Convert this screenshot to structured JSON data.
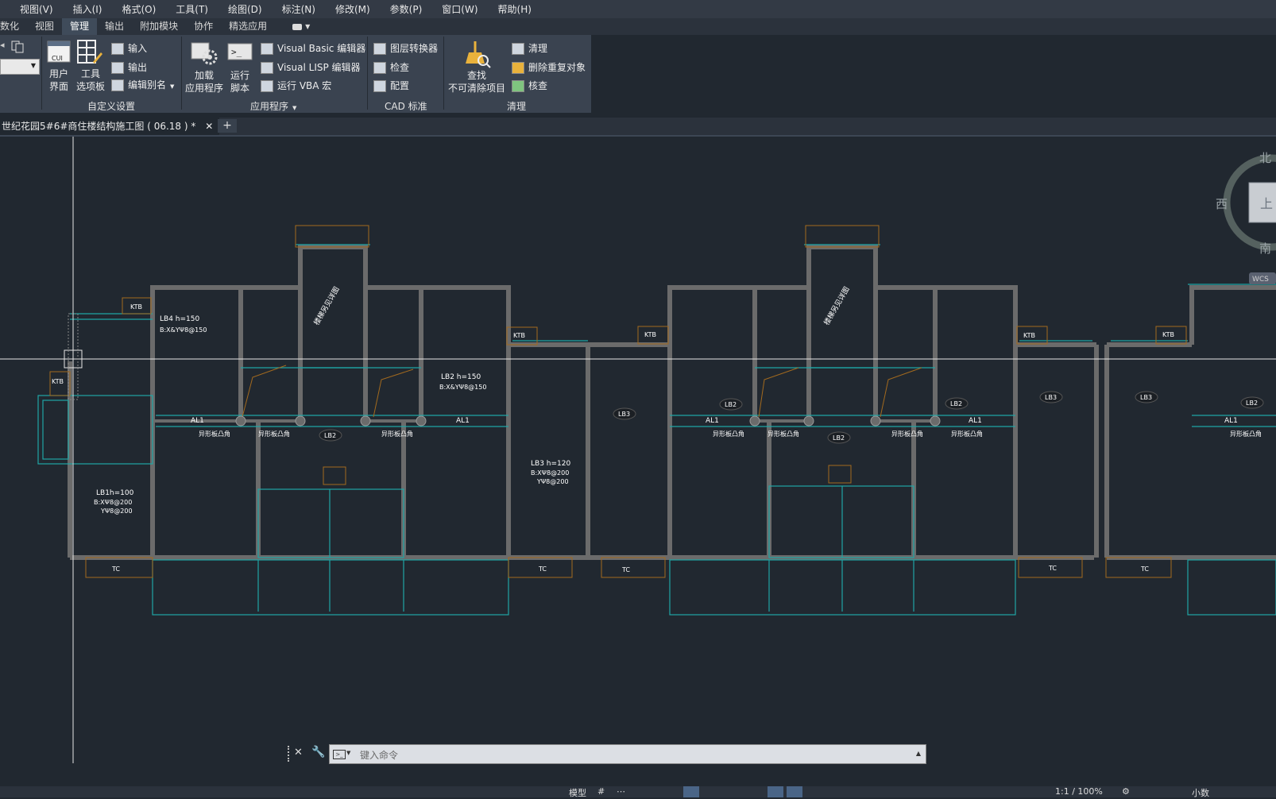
{
  "menubar": {
    "items": [
      "视图(V)",
      "插入(I)",
      "格式(O)",
      "工具(T)",
      "绘图(D)",
      "标注(N)",
      "修改(M)",
      "参数(P)",
      "窗口(W)",
      "帮助(H)"
    ]
  },
  "ribbon_tabs": [
    "参数化",
    "视图",
    "管理",
    "输出",
    "附加模块",
    "协作",
    "精选应用"
  ],
  "ribbon_active_tab": "管理",
  "ribbon": {
    "customize": {
      "title": "自定义设置",
      "user_interface": [
        "用户",
        "界面"
      ],
      "tool_palettes": [
        "工具",
        "选项板"
      ],
      "import": "输入",
      "export": "输出",
      "edit_aliases": "编辑别名"
    },
    "applications": {
      "title": "应用程序",
      "load_app": [
        "加载",
        "应用程序"
      ],
      "run_script": [
        "运行",
        "脚本"
      ],
      "vb_editor": "Visual Basic 编辑器",
      "lisp_editor": "Visual LISP 编辑器",
      "run_vba": "运行 VBA 宏"
    },
    "cad_standards": {
      "title": "CAD 标准",
      "layer_translator": "图层转换器",
      "check": "检查",
      "configure": "配置"
    },
    "cleanup": {
      "title": "清理",
      "find_non_purgeable": [
        "查找",
        "不可清除项目"
      ],
      "purge": "清理",
      "overkill": "删除重复对象",
      "audit": "核查"
    }
  },
  "document_tab": "世纪花园5#6#商住楼结构施工图 ( 06.18 ) *",
  "viewcube": {
    "north": "北",
    "west": "西",
    "south": "南",
    "top": "上",
    "wcs": "WCS"
  },
  "drawing_labels": {
    "ktb": "KTB",
    "tc": "TC",
    "al1": "AL1",
    "lb2": "LB2",
    "lb3": "LB3",
    "lb4_title": "LB4 h=150",
    "lb4_rebar": "B:X&YΨ8@150",
    "lb2_title": "LB2 h=150",
    "lb2_rebar": "B:X&YΨ8@150",
    "lb3_title": "LB3 h=120",
    "lb3_rebar_x": "B:XΨ8@200",
    "lb3_rebar_y": "YΨ8@200",
    "lb1_title": "LB1h=100",
    "lb1_rebar_x": "B:XΨ8@200",
    "lb1_rebar_y": "YΨ8@200",
    "stair_note": "楼梯另见详图",
    "beam_note": "异形板凸角"
  },
  "command_line": {
    "placeholder": "键入命令"
  },
  "statusbar": {
    "model": "模型",
    "scale": "1:1 / 100%",
    "units": "小数"
  }
}
